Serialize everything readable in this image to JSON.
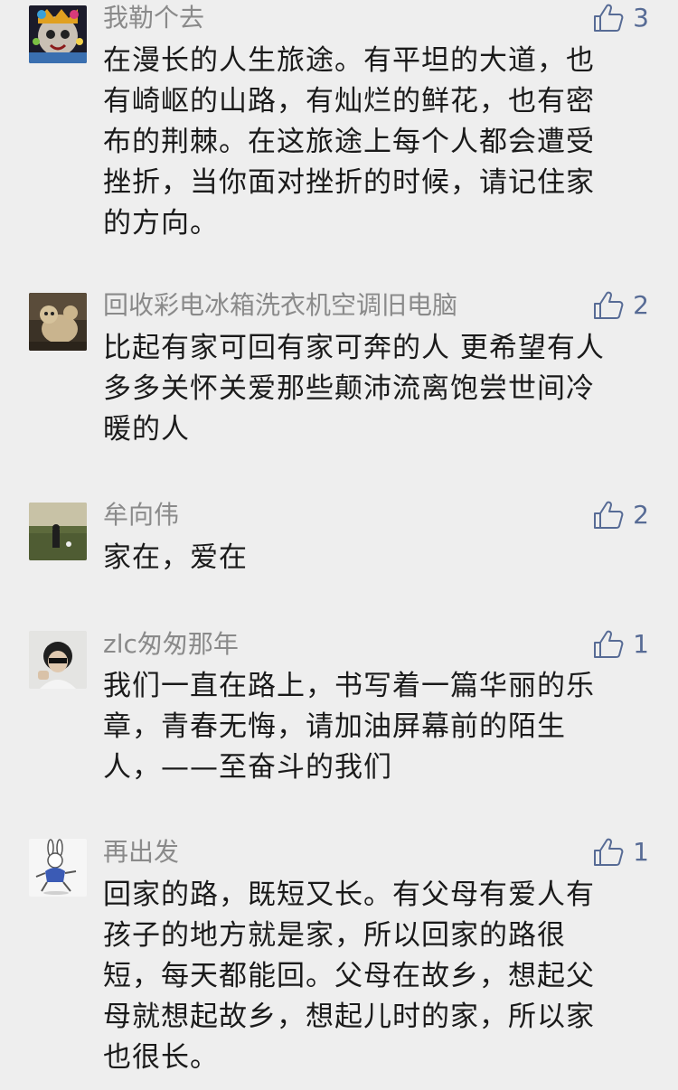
{
  "comments": [
    {
      "name": "我勒个去",
      "likes": "3",
      "lines": [
        "在漫长的人生旅途。有平坦的大道，也",
        "有崎岖的山路，有灿烂的鲜花，也有密",
        "布的荆棘。在这旅途上每个人都会遭受",
        "挫折，当你面对挫折的时候，请记住家",
        "的方向。"
      ]
    },
    {
      "name": "回收彩电冰箱洗衣机空调旧电脑",
      "likes": "2",
      "lines": [
        "比起有家可回有家可奔的人 更希望有人",
        "多多关怀关爱那些颠沛流离饱尝世间冷",
        "暖的人"
      ]
    },
    {
      "name": "牟向伟",
      "likes": "2",
      "lines": [
        "家在，爱在"
      ]
    },
    {
      "name": "zlc匆匆那年",
      "likes": "1",
      "lines": [
        "我们一直在路上，书写着一篇华丽的乐",
        "章，青春无悔，请加油屏幕前的陌生",
        "人，——至奋斗的我们"
      ]
    },
    {
      "name": "再出发",
      "likes": "1",
      "lines": [
        "回家的路，既短又长。有父母有爱人有",
        "孩子的地方就是家，所以回家的路很",
        "短，每天都能回。父母在故乡，想起父",
        "母就想起故乡，想起儿时的家，所以家",
        "也很长。"
      ]
    }
  ],
  "icons": {
    "like": "thumbs-up-icon"
  },
  "colors": {
    "background": "#eeeeee",
    "name": "#8a8a8a",
    "like": "#576b95",
    "text": "#1a1a1a"
  }
}
